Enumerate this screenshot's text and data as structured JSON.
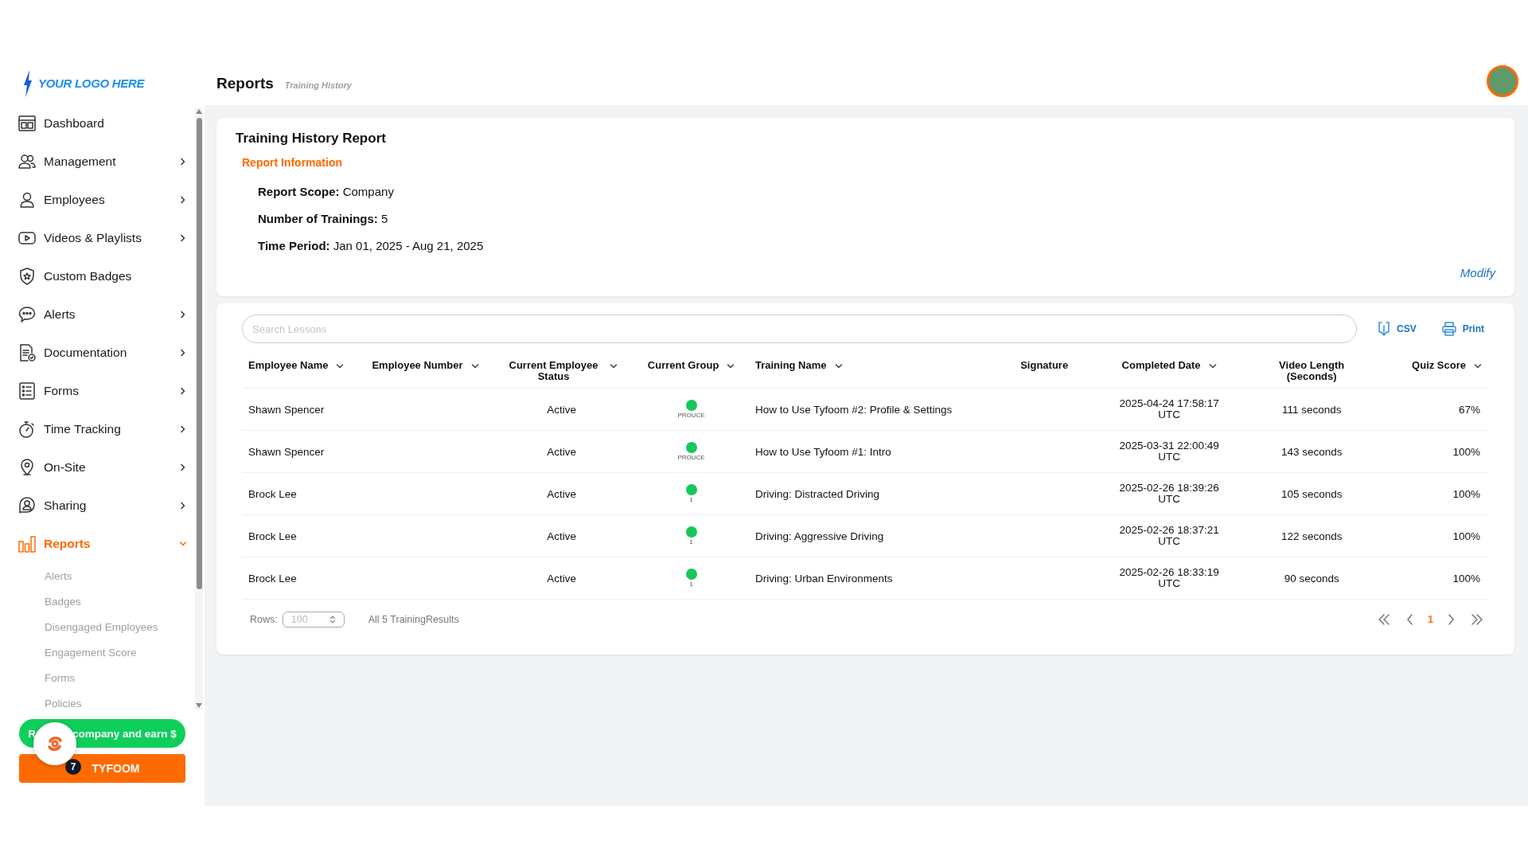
{
  "logo": {
    "text": "YOUR LOGO HERE"
  },
  "sidebar": {
    "items": [
      {
        "label": "Dashboard",
        "has_children": false,
        "selected": false
      },
      {
        "label": "Management",
        "has_children": true,
        "selected": false
      },
      {
        "label": "Employees",
        "has_children": true,
        "selected": false
      },
      {
        "label": "Videos & Playlists",
        "has_children": true,
        "selected": false
      },
      {
        "label": "Custom Badges",
        "has_children": false,
        "selected": false
      },
      {
        "label": "Alerts",
        "has_children": true,
        "selected": false
      },
      {
        "label": "Documentation",
        "has_children": true,
        "selected": false
      },
      {
        "label": "Forms",
        "has_children": true,
        "selected": false
      },
      {
        "label": "Time Tracking",
        "has_children": true,
        "selected": false
      },
      {
        "label": "On-Site",
        "has_children": true,
        "selected": false
      },
      {
        "label": "Sharing",
        "has_children": true,
        "selected": false
      },
      {
        "label": "Reports",
        "has_children": true,
        "selected": true,
        "expanded": true,
        "children": [
          {
            "label": "Alerts",
            "selected": false
          },
          {
            "label": "Badges",
            "selected": false
          },
          {
            "label": "Disengaged Employees",
            "selected": false
          },
          {
            "label": "Engagement Score",
            "selected": false
          },
          {
            "label": "Forms",
            "selected": false
          },
          {
            "label": "Policies",
            "selected": false
          }
        ]
      }
    ],
    "refer_button": {
      "visible_start": "R",
      "label": "company and earn $"
    },
    "brand_button": {
      "label": "TYFOOM"
    },
    "chat_widget": {
      "badge": "7"
    }
  },
  "header": {
    "title": "Reports",
    "breadcrumb": "Training History"
  },
  "report_info": {
    "title": "Training History Report",
    "section": "Report Information",
    "fields": [
      {
        "label": "Report Scope:",
        "value": "Company"
      },
      {
        "label": "Number of Trainings:",
        "value": "5"
      },
      {
        "label": "Time Period:",
        "value": "Jan 01, 2025 - Aug 21, 2025"
      }
    ],
    "modify_link": "Modify"
  },
  "results": {
    "search": {
      "placeholder": "Search Lessons"
    },
    "actions": [
      {
        "kind": "csv",
        "label": "CSV"
      },
      {
        "kind": "print",
        "label": "Print"
      }
    ],
    "table": {
      "columns": [
        {
          "label": "Employee Name",
          "sortable": true
        },
        {
          "label": "Employee Number",
          "sortable": true
        },
        {
          "label": "Current Employee Status",
          "sortable": true
        },
        {
          "label": "Current Group",
          "sortable": true
        },
        {
          "label": "Training Name",
          "sortable": true
        },
        {
          "label": "Signature",
          "sortable": false
        },
        {
          "label": "Completed Date",
          "sortable": true
        },
        {
          "label": "Video Length (Seconds)",
          "sortable": false
        },
        {
          "label": "Quiz Score",
          "sortable": true
        }
      ],
      "rows": [
        {
          "employee_name": "Shawn Spencer",
          "employee_number": "",
          "status": "Active",
          "group": "PROUCE",
          "training": "How to Use Tyfoom #2: Profile & Settings",
          "signature": "",
          "completed": "2025-04-24 17:58:17 UTC",
          "video_length": "111 seconds",
          "quiz_score": "67%"
        },
        {
          "employee_name": "Shawn Spencer",
          "employee_number": "",
          "status": "Active",
          "group": "PROUCE",
          "training": "How to Use Tyfoom #1: Intro",
          "signature": "",
          "completed": "2025-03-31 22:00:49 UTC",
          "video_length": "143 seconds",
          "quiz_score": "100%"
        },
        {
          "employee_name": "Brock Lee",
          "employee_number": "",
          "status": "Active",
          "group": "1",
          "training": "Driving: Distracted Driving",
          "signature": "",
          "completed": "2025-02-26 18:39:26 UTC",
          "video_length": "105 seconds",
          "quiz_score": "100%"
        },
        {
          "employee_name": "Brock Lee",
          "employee_number": "",
          "status": "Active",
          "group": "1",
          "training": "Driving: Aggressive Driving",
          "signature": "",
          "completed": "2025-02-26 18:37:21 UTC",
          "video_length": "122 seconds",
          "quiz_score": "100%"
        },
        {
          "employee_name": "Brock Lee",
          "employee_number": "",
          "status": "Active",
          "group": "1",
          "training": "Driving: Urban Environments",
          "signature": "",
          "completed": "2025-02-26 18:33:19 UTC",
          "video_length": "90 seconds",
          "quiz_score": "100%"
        }
      ]
    },
    "footer": {
      "rows_label": "Rows:",
      "rows_value": "100",
      "summary": "All 5 TrainingResults",
      "pages": [
        {
          "label": "1",
          "selected": true
        }
      ]
    }
  }
}
